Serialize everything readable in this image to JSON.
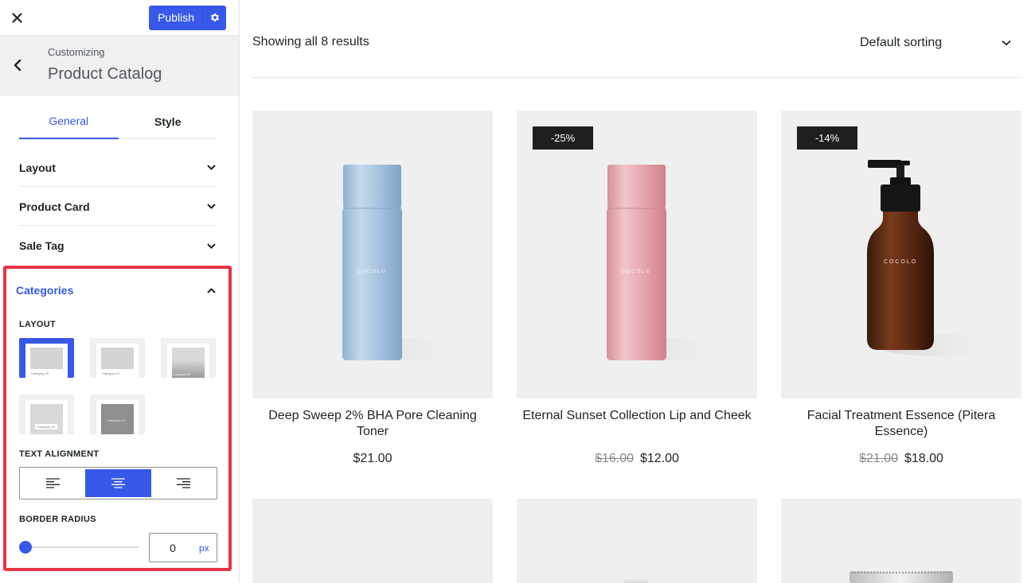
{
  "topbar": {
    "publish_label": "Publish"
  },
  "header": {
    "customizing_label": "Customizing",
    "title": "Product Catalog"
  },
  "tabs": [
    {
      "label": "General"
    },
    {
      "label": "Style"
    }
  ],
  "sections": [
    {
      "label": "Layout"
    },
    {
      "label": "Product Card"
    },
    {
      "label": "Sale Tag"
    }
  ],
  "categories": {
    "label": "Categories",
    "layout_label": "LAYOUT",
    "layout_option_caption": "Category 03",
    "text_alignment_label": "TEXT ALIGNMENT",
    "text_alignment_selected": "center",
    "border_radius_label": "BORDER RADIUS",
    "border_radius_value": "0",
    "border_radius_unit": "px"
  },
  "shop": {
    "results_text": "Showing all 8 results",
    "sorting_label": "Default sorting",
    "products": [
      {
        "name": "Deep Sweep 2% BHA Pore Cleaning Toner",
        "price": "$21.00",
        "old_price": "",
        "badge": "",
        "bottle_brand": "COCOLO"
      },
      {
        "name": "Eternal Sunset Collection Lip and Cheek",
        "price": "$12.00",
        "old_price": "$16.00",
        "badge": "-25%",
        "bottle_brand": "COCOLO"
      },
      {
        "name": "Facial Treatment Essence (Pitera Essence)",
        "price": "$18.00",
        "old_price": "$21.00",
        "badge": "-14%",
        "bottle_brand": "COCOLO"
      }
    ]
  },
  "colors": {
    "accent": "#3858e9",
    "highlight_border": "#e63346",
    "badge_bg": "#1f1f1f",
    "image_bg": "#efefef"
  }
}
